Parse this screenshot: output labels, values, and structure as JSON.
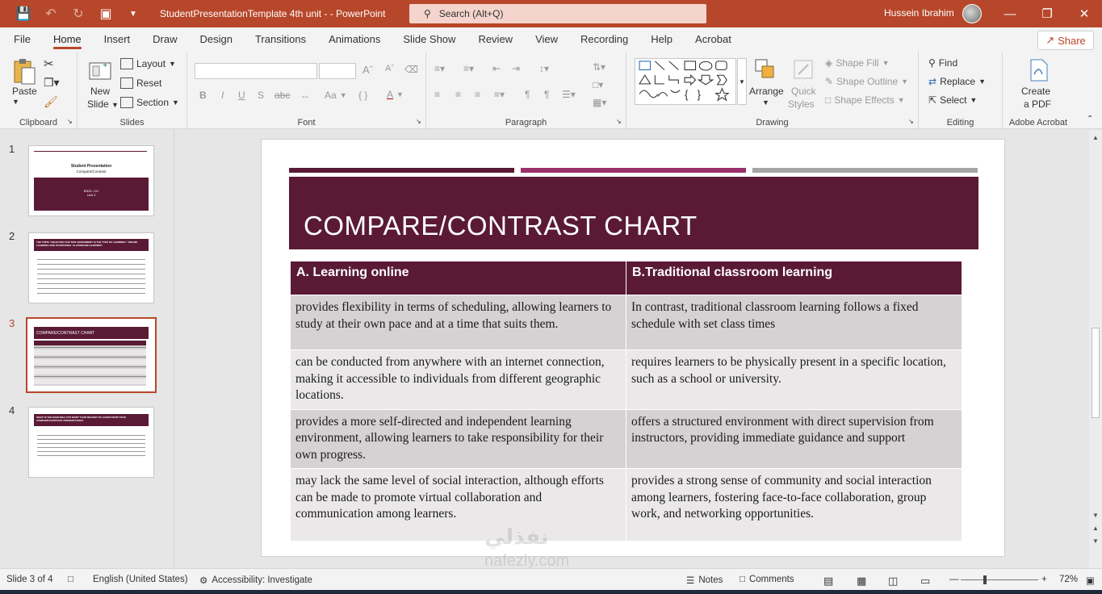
{
  "app": {
    "doc_title": "StudentPresentationTemplate 4th unit -  -  PowerPoint",
    "search_placeholder": "Search (Alt+Q)",
    "user_name": "Hussein Ibrahim"
  },
  "tabs": [
    "File",
    "Home",
    "Insert",
    "Draw",
    "Design",
    "Transitions",
    "Animations",
    "Slide Show",
    "Review",
    "View",
    "Recording",
    "Help",
    "Acrobat"
  ],
  "share_label": "Share",
  "ribbon": {
    "clipboard": {
      "label": "Clipboard",
      "paste": "Paste"
    },
    "slides": {
      "label": "Slides",
      "new_slide_1": "New",
      "new_slide_2": "Slide",
      "layout": "Layout",
      "reset": "Reset",
      "section": "Section"
    },
    "font": {
      "label": "Font",
      "bold": "B",
      "italic": "I",
      "underline": "U",
      "strike": "S",
      "case": "Aa"
    },
    "paragraph": {
      "label": "Paragraph"
    },
    "drawing": {
      "label": "Drawing",
      "arrange": "Arrange",
      "quick_styles_1": "Quick",
      "quick_styles_2": "Styles",
      "shape_fill": "Shape Fill",
      "shape_outline": "Shape Outline",
      "shape_effects": "Shape Effects"
    },
    "editing": {
      "label": "Editing",
      "find": "Find",
      "replace": "Replace",
      "select": "Select"
    },
    "acrobat": {
      "label": "Adobe Acrobat",
      "create_1": "Create",
      "create_2": "a PDF"
    }
  },
  "thumbnails": [
    {
      "num": "1",
      "title": "Student Presentation",
      "subtitle": "Compare/Contrast",
      "box_line1": "ENGL 101",
      "box_line2": "Unit 4"
    },
    {
      "num": "2",
      "title": "THE TOPIC I SELECTED FOR THIS ASSIGNMENT IS THE TYPE OF LEARNING: \"ONLINE LEARNING AND TRADITIONAL CLASSROOM LEARNING\""
    },
    {
      "num": "3",
      "title": "COMPARE/CONTRAST CHART"
    },
    {
      "num": "4",
      "title": "WHAT IS THE MAIN IDEA YOU WANT YOUR READER TO LEARN FROM YOUR COMPARE/CONTRAST PRESENTATION?"
    }
  ],
  "slide": {
    "title": "COMPARE/CONTRAST CHART",
    "headers": [
      "A.  Learning online",
      "B.Traditional classroom learning"
    ],
    "rows": [
      [
        "provides flexibility in terms of scheduling, allowing learners to study at their own pace and at a time that suits them.",
        "In contrast, traditional classroom learning follows a fixed schedule with set class times"
      ],
      [
        " can be conducted from anywhere with an internet connection, making it accessible to individuals from different geographic locations.",
        " requires learners to be physically present in a specific location, such as a school or university."
      ],
      [
        "provides a more self-directed and independent learning environment, allowing learners to take responsibility for their own progress.",
        "offers a structured environment with direct supervision from instructors, providing immediate guidance and support"
      ],
      [
        "may lack the same level of social interaction, although efforts can be made to promote virtual collaboration and communication among learners.",
        "provides a strong sense of community and social interaction among learners, fostering face-to-face collaboration, group work, and networking opportunities."
      ]
    ]
  },
  "status": {
    "slide_of": "Slide 3 of 4",
    "language": "English (United States)",
    "accessibility": "Accessibility: Investigate",
    "notes": "Notes",
    "comments": "Comments",
    "zoom": "72%"
  },
  "watermark": {
    "line1": "نفذلي",
    "line2": "nafezly.com"
  },
  "colors": {
    "accent": "#b7472a",
    "slide_title_bg": "#5a1a35",
    "stripe_1": "#5a1a35",
    "stripe_2": "#9c2f6c",
    "stripe_3": "#a5a5a5"
  }
}
